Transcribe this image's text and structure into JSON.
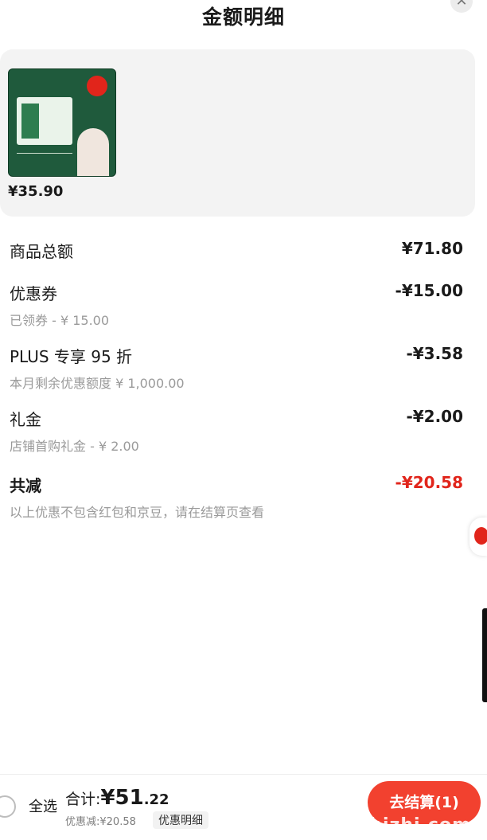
{
  "header": {
    "title": "金额明细",
    "close_icon": "close-icon"
  },
  "product": {
    "price": "¥35.90",
    "image": "milk-gift-box-image"
  },
  "breakdown": {
    "goods_total": {
      "label": "商品总额",
      "value": "¥71.80"
    },
    "coupon": {
      "label": "优惠券",
      "value": "-¥15.00",
      "sub": "已领券 - ¥ 15.00"
    },
    "plus": {
      "label": "PLUS 专享 95 折",
      "value": "-¥3.58",
      "sub": "本月剩余优惠额度 ¥ 1,000.00"
    },
    "gift": {
      "label": "礼金",
      "value": "-¥2.00",
      "sub": "店铺首购礼金 - ¥ 2.00"
    },
    "total_discount": {
      "label": "共减",
      "value": "-¥20.58",
      "note": "以上优惠不包含红包和京豆，请在结算页查看"
    }
  },
  "bottom_bar": {
    "select_all": "全选",
    "total_label": "合计:",
    "total_currency": "¥",
    "total_integer": "51",
    "total_decimal": ".22",
    "discount_text": "优惠减:¥20.58",
    "detail_button": "优惠明细",
    "checkout_button": "去结算(1)",
    "watermark": "zhizhizhi.com"
  },
  "colors": {
    "accent_red": "#e1251b",
    "card_bg": "#f3f3f3",
    "muted_text": "#9a9a9a"
  }
}
